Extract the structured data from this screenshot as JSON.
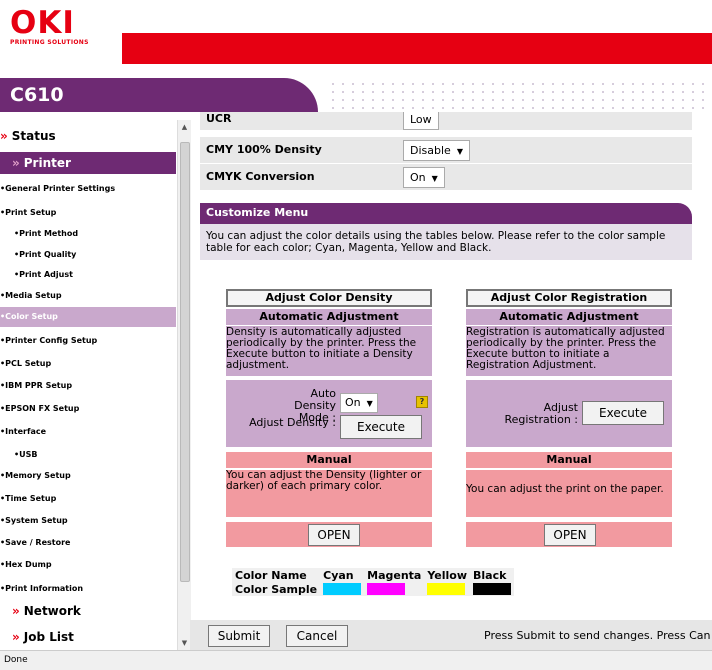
{
  "brand": {
    "logo_text": "OKI",
    "tagline": "PRINTING SOLUTIONS",
    "model": "C610"
  },
  "nav": {
    "items": [
      {
        "label": "Status",
        "kind": "main"
      },
      {
        "label": "Printer",
        "kind": "main-active"
      },
      {
        "label": "•General Printer Settings",
        "kind": "l1"
      },
      {
        "label": "•Print Setup",
        "kind": "l1"
      },
      {
        "label": "•Print Method",
        "kind": "l2"
      },
      {
        "label": "•Print Quality",
        "kind": "l2"
      },
      {
        "label": "•Print Adjust",
        "kind": "l2"
      },
      {
        "label": "•Media Setup",
        "kind": "l1"
      },
      {
        "label": "•Color Setup",
        "kind": "l1-active"
      },
      {
        "label": "•Printer Config Setup",
        "kind": "l1"
      },
      {
        "label": "•PCL Setup",
        "kind": "l1"
      },
      {
        "label": "•IBM PPR Setup",
        "kind": "l1"
      },
      {
        "label": "•EPSON FX Setup",
        "kind": "l1"
      },
      {
        "label": "•Interface",
        "kind": "l1"
      },
      {
        "label": "•USB",
        "kind": "l2"
      },
      {
        "label": "•Memory Setup",
        "kind": "l1"
      },
      {
        "label": "•Time Setup",
        "kind": "l1"
      },
      {
        "label": "•System Setup",
        "kind": "l1"
      },
      {
        "label": "•Save / Restore",
        "kind": "l1"
      },
      {
        "label": "•Hex Dump",
        "kind": "l1"
      },
      {
        "label": "•Print Information",
        "kind": "l1"
      },
      {
        "label": "Network",
        "kind": "main"
      },
      {
        "label": "Job List",
        "kind": "main"
      }
    ]
  },
  "settings": {
    "partial_label": "UCR",
    "partial_value": "Low",
    "cmy_label": "CMY 100% Density",
    "cmy_value": "Disable",
    "cmyk_label": "CMYK Conversion",
    "cmyk_value": "On"
  },
  "customize": {
    "title": "Customize Menu",
    "desc": "You can adjust the color details using the tables below. Please refer to the color sample table for each color; Cyan, Magenta, Yellow and Black."
  },
  "density": {
    "title": "Adjust Color Density",
    "auto_header": "Automatic Adjustment",
    "auto_desc": "Density is automatically adjusted periodically by the printer. Press the Execute button to initiate a Density adjustment.",
    "mode_label": "Auto Density Mode :",
    "mode_value": "On",
    "adjust_label": "Adjust Density :",
    "execute": "Execute",
    "manual_header": "Manual",
    "manual_desc": "You can adjust the Density (lighter or darker) of each primary color.",
    "open": "OPEN"
  },
  "registration": {
    "title": "Adjust Color Registration",
    "auto_header": "Automatic Adjustment",
    "auto_desc": "Registration is automatically adjusted periodically by the printer. Press the Execute button to initiate a Registration Adjustment.",
    "adjust_label": "Adjust Registration :",
    "execute": "Execute",
    "manual_header": "Manual",
    "manual_desc": "You can adjust the print on the paper.",
    "open": "OPEN"
  },
  "color_table": {
    "name_header": "Color Name",
    "sample_label": "Color Sample",
    "colors": [
      {
        "name": "Cyan",
        "hex": "#00ccff"
      },
      {
        "name": "Magenta",
        "hex": "#ff00ff"
      },
      {
        "name": "Yellow",
        "hex": "#ffff00"
      },
      {
        "name": "Black",
        "hex": "#000000"
      }
    ]
  },
  "footer": {
    "submit": "Submit",
    "cancel": "Cancel",
    "message": "Press Submit to send changes. Press Can"
  },
  "status": "Done",
  "colors": {
    "brand_red": "#e60012",
    "purple": "#6e2a73",
    "lavender": "#c9a8cc",
    "pink": "#f29aa0"
  }
}
